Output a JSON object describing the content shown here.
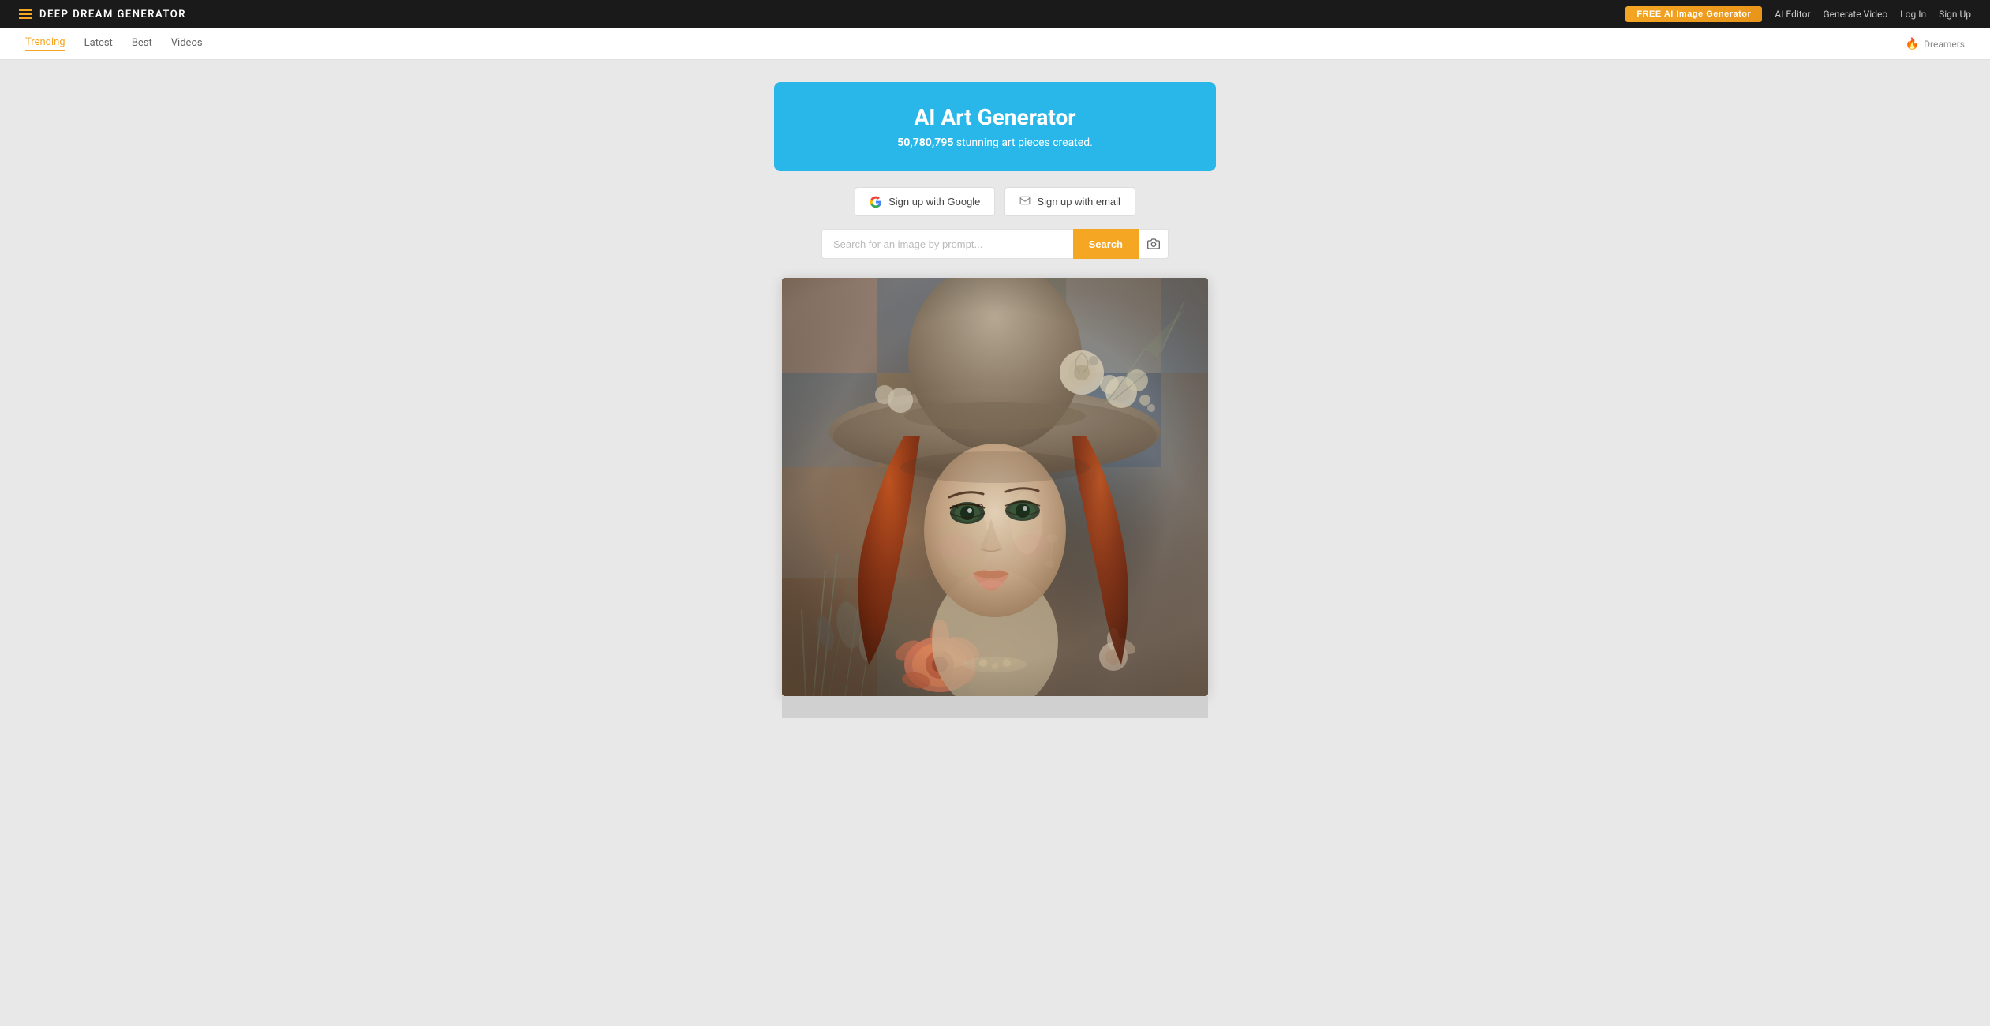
{
  "topNav": {
    "brandName": "DEEP DREAM GENERATOR",
    "freeButtonLabel": "FREE AI Image Generator",
    "navLinks": [
      {
        "label": "AI Editor",
        "id": "ai-editor"
      },
      {
        "label": "Generate Video",
        "id": "generate-video"
      },
      {
        "label": "Log In",
        "id": "login"
      },
      {
        "label": "Sign Up",
        "id": "signup"
      }
    ]
  },
  "subNav": {
    "items": [
      {
        "label": "Trending",
        "active": true
      },
      {
        "label": "Latest",
        "active": false
      },
      {
        "label": "Best",
        "active": false
      },
      {
        "label": "Videos",
        "active": false
      }
    ],
    "dreamersLabel": "Dreamers"
  },
  "hero": {
    "title": "AI Art Generator",
    "subtitle_count": "50,780,795",
    "subtitle_text": "stunning art pieces created."
  },
  "auth": {
    "googleLabel": "Sign up with Google",
    "emailLabel": "Sign up with email"
  },
  "search": {
    "placeholder": "Search for an image by prompt...",
    "buttonLabel": "Search"
  },
  "footer": {
    "loadMoreHint": ""
  }
}
